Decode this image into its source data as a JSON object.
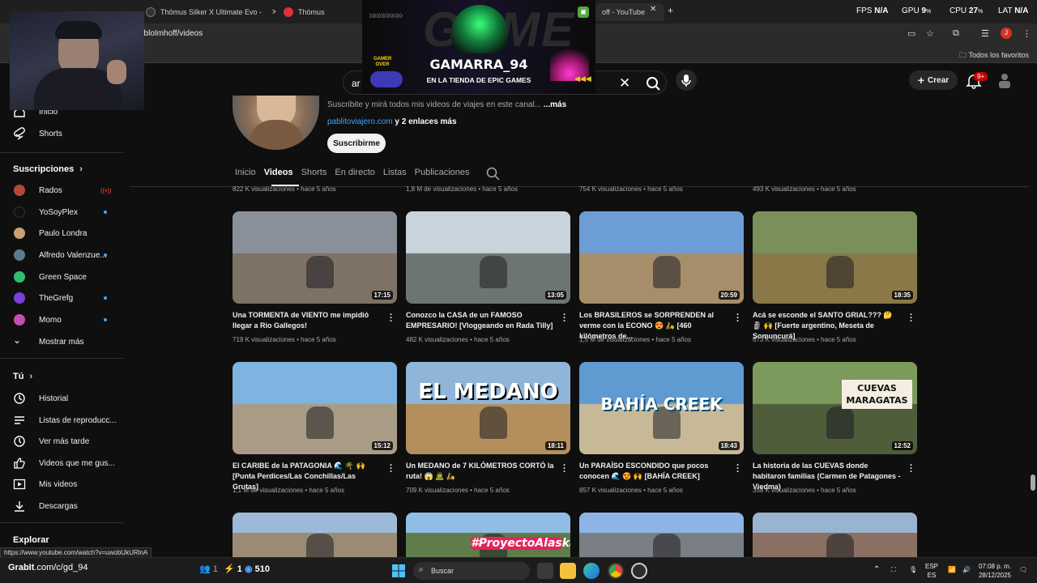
{
  "browser": {
    "tabs": [
      {
        "title": "Thömus Silker X Ultimate Evo -",
        "favicon_color": "#333333"
      },
      {
        "title": "Thömus",
        "favicon_color": "#e0303a"
      },
      {
        "title": "off - YouTube",
        "favicon_color": "#ff0000"
      }
    ],
    "new_tab": "+",
    "url": "abloImhoff/videos",
    "bookmarks_all": "Todos los favoritos",
    "perf": {
      "fps_label": "FPS",
      "fps_value": "N/A",
      "gpu_label": "GPU",
      "gpu_value": "9",
      "gpu_unit": "%",
      "cpu_label": "CPU",
      "cpu_value": "27",
      "cpu_unit": "%",
      "lat_label": "LAT",
      "lat_value": "N/A"
    },
    "profile_initial": "J"
  },
  "youtube": {
    "search_value": "ar",
    "create_label": "Crear",
    "notifications_badge": "9+",
    "sidebar": {
      "top": [
        {
          "label": "Inicio",
          "icon": "home-icon"
        },
        {
          "label": "Shorts",
          "icon": "shorts-icon"
        }
      ],
      "subscriptions_title": "Suscripciones",
      "subscriptions": [
        {
          "label": "Rados",
          "avatar_color": "#b5483b",
          "live": true
        },
        {
          "label": "YoSoyPlex",
          "avatar_color": "#111111",
          "dot": true
        },
        {
          "label": "Paulo Londra",
          "avatar_color": "#c89f77",
          "dot": false
        },
        {
          "label": "Alfredo Valenzue...",
          "avatar_color": "#5b7b8f",
          "dot": true
        },
        {
          "label": "Green Space",
          "avatar_color": "#2fbf71",
          "dot": false
        },
        {
          "label": "TheGrefg",
          "avatar_color": "#7b3fd8",
          "dot": true
        },
        {
          "label": "Momo",
          "avatar_color": "#c24fb0",
          "dot": true
        }
      ],
      "show_more": "Mostrar más",
      "you_title": "Tú",
      "you_items": [
        {
          "label": "Historial",
          "icon": "history-icon"
        },
        {
          "label": "Listas de reproducc...",
          "icon": "playlists-icon"
        },
        {
          "label": "Ver más tarde",
          "icon": "watch-later-icon"
        },
        {
          "label": "Videos que me gus...",
          "icon": "like-icon"
        },
        {
          "label": "Mis videos",
          "icon": "my-videos-icon"
        },
        {
          "label": "Descargas",
          "icon": "download-icon"
        }
      ],
      "explore_title": "Explorar"
    },
    "channel": {
      "description": "Suscribite y mirá todos mis videos de viajes en este canal...",
      "description_more": "...más",
      "link": "pablitoviajero.com",
      "link_more": "y 2 enlaces más",
      "subscribe": "Suscribirme",
      "tabs": [
        "Inicio",
        "Videos",
        "Shorts",
        "En directo",
        "Listas",
        "Publicaciones"
      ],
      "active_tab": "Videos"
    },
    "prev_row_meta": [
      "822 K visualizaciones • hace 5 años",
      "1,8 M de visualizaciones • hace 5 años",
      "754 K visualizaciones • hace 5 años",
      "493 K visualizaciones • hace 5 años"
    ],
    "videos": [
      {
        "title": "Una TORMENTA de VIENTO me impidió llegar a Rio Gallegos!",
        "meta": "719 K visualizaciones • hace 5 años",
        "duration": "17:15",
        "sky": "#8a9099",
        "ground": "#7d7265",
        "overlay": ""
      },
      {
        "title": "Conozco la CASA de un FAMOSO EMPRESARIO! [Vloggeando en Rada Tilly]",
        "meta": "482 K visualizaciones • hace 5 años",
        "duration": "13:05",
        "sky": "#c9d3dc",
        "ground": "#6d7570",
        "overlay": ""
      },
      {
        "title": "Los BRASILEROS se SORPRENDEN al verme con la ECONO 😍 🛵 [460 kilómetros de...",
        "meta": "1,5 M de visualizaciones • hace 5 años",
        "duration": "20:59",
        "sky": "#6d9dd6",
        "ground": "#a68e6a",
        "overlay": ""
      },
      {
        "title": "Acá se esconde el SANTO GRIAL??? 🤔 🗿 🙌 [Fuerte argentino, Meseta de Somuncurá]",
        "meta": "673 K visualizaciones • hace 5 años",
        "duration": "18:35",
        "sky": "#7a8f5a",
        "ground": "#8a7848",
        "overlay": ""
      },
      {
        "title": "El CARIBE de la PATAGONIA 🌊 🌴 🙌 [Punta Perdices/Las Conchillas/Las Grutas]",
        "meta": "1,1 M de visualizaciones • hace 5 años",
        "duration": "15:12",
        "sky": "#7fb3e0",
        "ground": "#a89c86",
        "overlay": ""
      },
      {
        "title": "Un MEDANO de 7 KILÓMETROS CORTÓ la ruta! 😱 🧟 🛵",
        "meta": "709 K visualizaciones • hace 5 años",
        "duration": "18:11",
        "sky": "#8fb6d8",
        "ground": "#b48f5d",
        "overlay": "EL MEDANO"
      },
      {
        "title": "Un PARAÍSO ESCONDIDO que pocos conocen 🌊 😍 🙌 [BAHÍA CREEK]",
        "meta": "857 K visualizaciones • hace 5 años",
        "duration": "18:43",
        "sky": "#5f9ad1",
        "ground": "#c7b998",
        "overlay": "BAHÍA CREEK"
      },
      {
        "title": "La historia de las CUEVAS donde habitaron familias (Carmen de Patagones - Viedma)",
        "meta": "358 K visualizaciones • hace 5 años",
        "duration": "12:52",
        "sky": "#7c9a5c",
        "ground": "#4f5d3a",
        "overlay": "CUEVAS MARAGATAS"
      },
      {
        "title": "",
        "meta": "",
        "duration": "",
        "sky": "#9cb9d8",
        "ground": "#9b8a74",
        "overlay": ""
      },
      {
        "title": "",
        "meta": "",
        "duration": "",
        "sky": "#8fbde6",
        "ground": "#5f7c4a",
        "overlay": "#ProyectoAlaska"
      },
      {
        "title": "",
        "meta": "",
        "duration": "",
        "sky": "#8db4e4",
        "ground": "#7a7f86",
        "overlay": ""
      },
      {
        "title": "",
        "meta": "",
        "duration": "",
        "sky": "#9ab3cf",
        "ground": "#8a6f63",
        "overlay": ""
      }
    ]
  },
  "overlay_promo": {
    "name": "GAMARRA_94",
    "tagline": "EN LA TIENDA DE EPIC GAMES",
    "badge": "GAMER OVER",
    "bg_word": "GAME"
  },
  "status_url": "https://www.youtube.com/watch?v=uwobUkURlnA",
  "stream_bar": {
    "handle": ".com/c/gd_94",
    "prefix": "GrabIt",
    "users": "1",
    "boosts": "1",
    "points": "510"
  },
  "taskbar": {
    "search_label": "Buscar",
    "lang": "ESP",
    "lang_sub": "ES",
    "time": "07:08 p. m.",
    "date": "28/12/2025"
  }
}
